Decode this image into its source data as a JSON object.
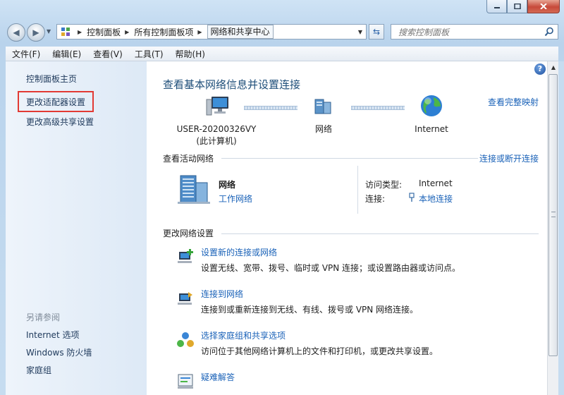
{
  "window": {
    "minimize_icon": "minimize-icon",
    "maximize_icon": "maximize-icon",
    "close_icon": "close-icon"
  },
  "nav": {
    "breadcrumbs": [
      "控制面板",
      "所有控制面板项",
      "网络和共享中心"
    ],
    "search_placeholder": "搜索控制面板"
  },
  "menu": [
    "文件(F)",
    "编辑(E)",
    "查看(V)",
    "工具(T)",
    "帮助(H)"
  ],
  "sidebar": {
    "items": [
      "控制面板主页",
      "更改适配器设置",
      "更改高级共享设置"
    ],
    "see_also_header": "另请参阅",
    "see_also": [
      "Internet 选项",
      "Windows 防火墙",
      "家庭组"
    ]
  },
  "main": {
    "title": "查看基本网络信息并设置连接",
    "full_map_link": "查看完整映射",
    "map": {
      "computer_name": "USER-20200326VY",
      "computer_sub": "(此计算机)",
      "network": "网络",
      "internet": "Internet"
    },
    "active_header": "查看活动网络",
    "connect_link": "连接或断开连接",
    "network": {
      "name": "网络",
      "type": "工作网络",
      "access_label": "访问类型:",
      "access_value": "Internet",
      "conn_label": "连接:",
      "conn_value": "本地连接"
    },
    "change_header": "更改网络设置",
    "tasks": [
      {
        "title": "设置新的连接或网络",
        "desc": "设置无线、宽带、拨号、临时或 VPN 连接；或设置路由器或访问点。"
      },
      {
        "title": "连接到网络",
        "desc": "连接到或重新连接到无线、有线、拨号或 VPN 网络连接。"
      },
      {
        "title": "选择家庭组和共享选项",
        "desc": "访问位于其他网络计算机上的文件和打印机，或更改共享设置。"
      },
      {
        "title": "疑难解答",
        "desc": ""
      }
    ]
  },
  "colors": {
    "link": "#1a62b8",
    "title": "#1e4e79",
    "highlight_box": "#e23a34"
  }
}
